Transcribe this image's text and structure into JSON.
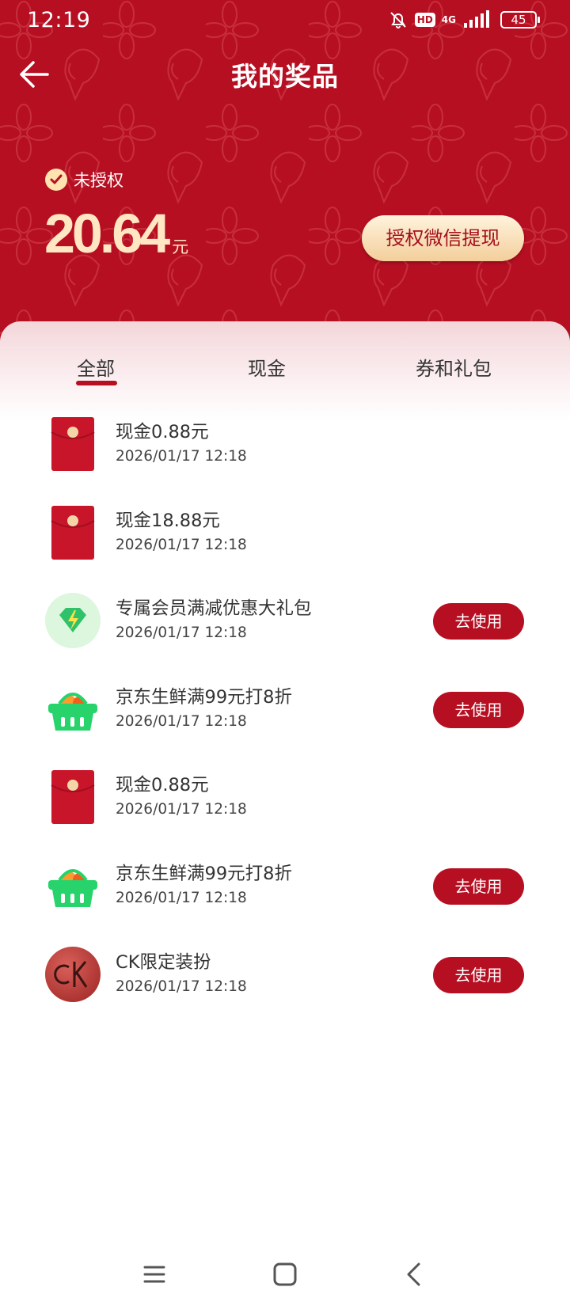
{
  "status_bar": {
    "time": "12:19",
    "hd": "HD",
    "network": "4G",
    "battery": "45"
  },
  "header": {
    "title": "我的奖品",
    "auth_status": "未授权",
    "balance": "20.64",
    "balance_unit": "元",
    "withdraw_button": "授权微信提现"
  },
  "tabs": [
    {
      "label": "全部",
      "active": true
    },
    {
      "label": "现金",
      "active": false
    },
    {
      "label": "券和礼包",
      "active": false
    }
  ],
  "items": [
    {
      "icon": "red-envelope-icon",
      "title": "现金0.88元",
      "time": "2026/01/17 12:18",
      "action": ""
    },
    {
      "icon": "red-envelope-icon",
      "title": "现金18.88元",
      "time": "2026/01/17 12:18",
      "action": ""
    },
    {
      "icon": "diamond-icon",
      "title": "专属会员满减优惠大礼包",
      "time": "2026/01/17 12:18",
      "action": "去使用"
    },
    {
      "icon": "basket-icon",
      "title": "京东生鲜满99元打8折",
      "time": "2026/01/17 12:18",
      "action": "去使用"
    },
    {
      "icon": "red-envelope-icon",
      "title": "现金0.88元",
      "time": "2026/01/17 12:18",
      "action": ""
    },
    {
      "icon": "basket-icon",
      "title": "京东生鲜满99元打8折",
      "time": "2026/01/17 12:18",
      "action": "去使用"
    },
    {
      "icon": "ck-logo-icon",
      "title": "CK限定装扮",
      "time": "2026/01/17 12:18",
      "action": "去使用"
    }
  ],
  "colors": {
    "primary": "#b70f22",
    "gold": "#ffe7c4"
  }
}
